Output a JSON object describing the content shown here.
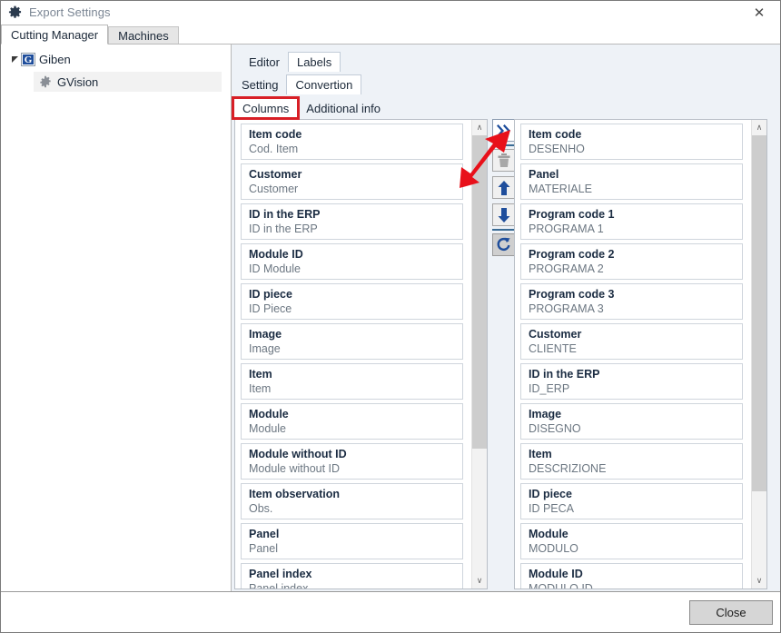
{
  "window": {
    "title": "Export Settings",
    "gear_icon": "gear-icon",
    "close_icon": "close-icon",
    "close_glyph": "✕"
  },
  "outer_tabs": [
    {
      "label": "Cutting Manager",
      "active": true
    },
    {
      "label": "Machines",
      "active": false
    }
  ],
  "tree": {
    "root": {
      "label": "Giben",
      "icon": "giben-logo-icon",
      "expand_glyph": "◢"
    },
    "child": {
      "label": "GVision",
      "icon": "gear-icon"
    }
  },
  "tabs_level1": [
    {
      "label": "Editor",
      "state": "unselected"
    },
    {
      "label": "Labels",
      "state": "selected"
    }
  ],
  "tabs_level2": [
    {
      "label": "Setting",
      "state": "unselected"
    },
    {
      "label": "Convertion",
      "state": "selected"
    }
  ],
  "tabs_level3": [
    {
      "label": "Columns",
      "state": "selected",
      "highlight_box": true
    },
    {
      "label": "Additional info",
      "state": "unselected"
    }
  ],
  "highlight_color": "#d81f26",
  "accent_color": "#1f4e9c",
  "buttons": [
    {
      "name": "move-right-button",
      "icon": "double-chevron-right-icon",
      "glyph": "»",
      "state": "hover",
      "color": "#1f4e9c"
    },
    {
      "name": "delete-button",
      "icon": "trash-icon",
      "glyph": "Ὕ1",
      "state": "normal",
      "color": "#9a9a9a"
    },
    {
      "name": "move-up-button",
      "icon": "arrow-up-icon",
      "glyph": "↑",
      "state": "normal",
      "color": "#1f4e9c"
    },
    {
      "name": "move-down-button",
      "icon": "arrow-down-icon",
      "glyph": "↓",
      "state": "normal",
      "color": "#1f4e9c"
    },
    {
      "name": "refresh-button",
      "icon": "refresh-icon",
      "glyph": "↻",
      "state": "normal",
      "color": "#1f4e9c"
    }
  ],
  "left_list": {
    "name": "available-columns-list",
    "scroll_up_glyph": "∧",
    "scroll_down_glyph": "∨",
    "items": [
      {
        "title": "Item code",
        "sub": "Cod. Item"
      },
      {
        "title": "Customer",
        "sub": "Customer"
      },
      {
        "title": "ID in the ERP",
        "sub": "ID in the ERP"
      },
      {
        "title": "Module ID",
        "sub": "ID Module"
      },
      {
        "title": "ID piece",
        "sub": "ID Piece"
      },
      {
        "title": "Image",
        "sub": "Image"
      },
      {
        "title": "Item",
        "sub": "Item"
      },
      {
        "title": "Module",
        "sub": "Module"
      },
      {
        "title": "Module without ID",
        "sub": "Module without ID"
      },
      {
        "title": "Item observation",
        "sub": "Obs."
      },
      {
        "title": "Panel",
        "sub": "Panel"
      },
      {
        "title": "Panel index",
        "sub": "Panel index"
      }
    ]
  },
  "right_list": {
    "name": "selected-columns-list",
    "scroll_up_glyph": "∧",
    "scroll_down_glyph": "∨",
    "items": [
      {
        "title": "Item code",
        "sub": "DESENHO"
      },
      {
        "title": "Panel",
        "sub": "MATERIALE"
      },
      {
        "title": "Program code 1",
        "sub": "PROGRAMA 1"
      },
      {
        "title": "Program code 2",
        "sub": "PROGRAMA 2"
      },
      {
        "title": "Program code 3",
        "sub": "PROGRAMA 3"
      },
      {
        "title": "Customer",
        "sub": "CLIENTE"
      },
      {
        "title": "ID in the ERP",
        "sub": "ID_ERP"
      },
      {
        "title": "Image",
        "sub": "DISEGNO"
      },
      {
        "title": "Item",
        "sub": "DESCRIZIONE"
      },
      {
        "title": "ID piece",
        "sub": "ID PECA"
      },
      {
        "title": "Module",
        "sub": "MODULO"
      },
      {
        "title": "Module ID",
        "sub": "MODULO ID"
      }
    ]
  },
  "footer": {
    "close_label": "Close"
  }
}
